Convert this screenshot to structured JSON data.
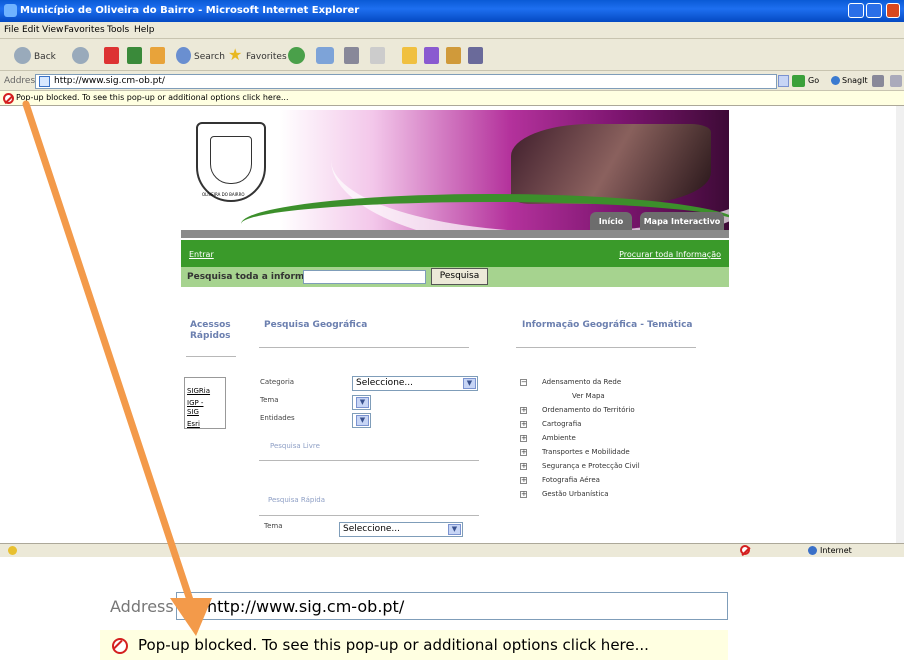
{
  "window": {
    "title": "Município de Oliveira do Bairro - Microsoft Internet Explorer"
  },
  "menu": [
    "File",
    "Edit",
    "View",
    "Favorites",
    "Tools",
    "Help"
  ],
  "toolbar": {
    "back": "Back",
    "search": "Search",
    "favorites": "Favorites"
  },
  "address": {
    "label": "Address",
    "url": "http://www.sig.cm-ob.pt/",
    "go": "Go",
    "snagit": "SnagIt"
  },
  "popup": {
    "message": "Pop-up blocked. To see this pop-up or additional options click here..."
  },
  "status": {
    "zone": "Internet"
  },
  "site": {
    "crest_text": "OLIVEIRA DO BAIRRO",
    "tabs": [
      "Início",
      "Mapa Interactivo"
    ],
    "login": "Entrar",
    "search_all_link": "Procurar toda Informação",
    "search_label": "Pesquisa toda a informação:",
    "search_button": "Pesquisa",
    "quick_access": {
      "title_line1": "Acessos",
      "title_line2": "Rápidos",
      "links": [
        "SIGRia",
        "IGP -",
        "SIG",
        "Esri"
      ]
    },
    "geo_search": {
      "title": "Pesquisa Geográfica",
      "labels": [
        "Categoria",
        "Tema",
        "Entidades"
      ],
      "category_value": "Seleccione...",
      "free_search": "Pesquisa Livre",
      "quick_search": "Pesquisa Rápida",
      "theme_label": "Tema",
      "theme_value": "Seleccione..."
    },
    "thematic": {
      "title": "Informação Geográfica - Temática",
      "expanded": "Adensamento da Rede",
      "view_map": "Ver Mapa",
      "items": [
        "Ordenamento do Território",
        "Cartografia",
        "Ambiente",
        "Transportes e Mobilidade",
        "Segurança e Protecção Civil",
        "Fotografia Aérea",
        "Gestão Urbanística"
      ]
    }
  },
  "zoom": {
    "address_label": "Address",
    "url": "http://www.sig.cm-ob.pt/",
    "popup_message": "Pop-up blocked. To see this pop-up or additional options click here..."
  },
  "colors": {
    "arrow": "#f39a4a",
    "site_green": "#3a9a2a",
    "site_light_green": "#a6d38f",
    "site_magenta": "#b4329c",
    "xp_blue": "#0a5ad6"
  }
}
